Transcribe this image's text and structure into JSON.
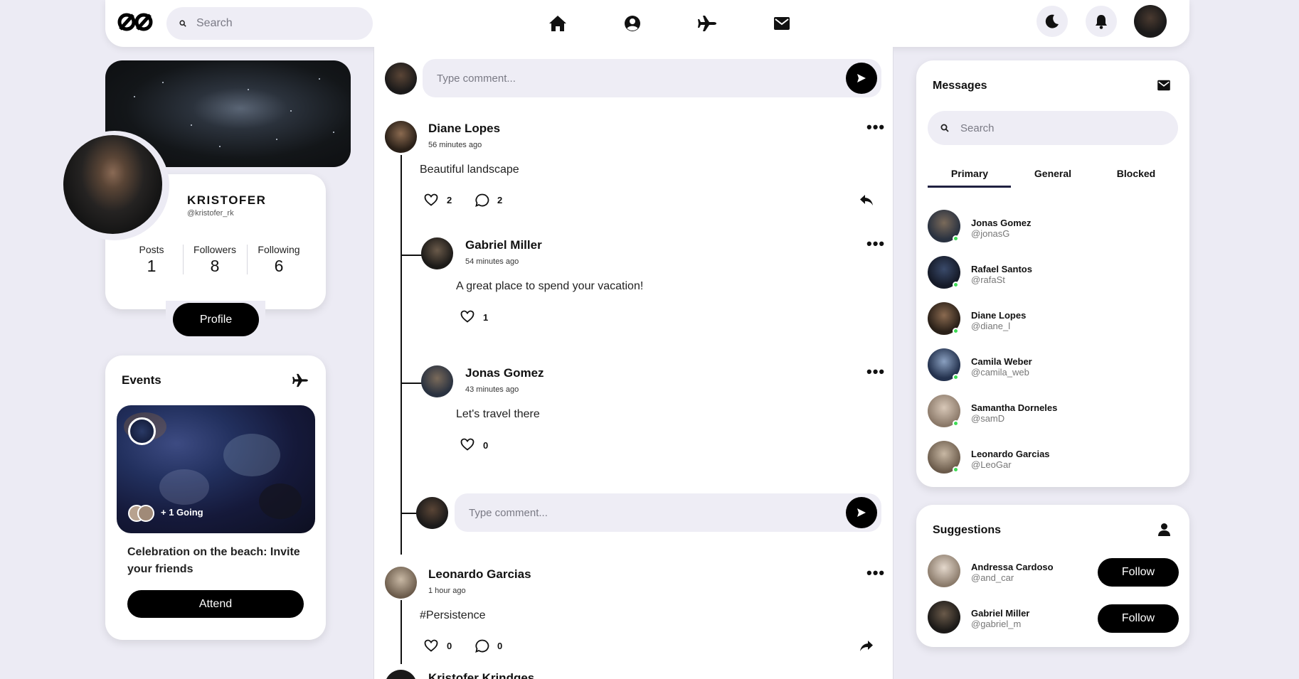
{
  "search": {
    "placeholder": "Search"
  },
  "profile": {
    "name": "KRISTOFER",
    "handle": "@kristofer_rk",
    "stats": [
      {
        "label": "Posts",
        "value": "1"
      },
      {
        "label": "Followers",
        "value": "8"
      },
      {
        "label": "Following",
        "value": "6"
      }
    ],
    "button": "Profile"
  },
  "events": {
    "title": "Events",
    "going": "+ 1 Going",
    "description": "Celebration on the beach: Invite your friends",
    "attend": "Attend"
  },
  "feed": {
    "comment_placeholder": "Type comment...",
    "posts": [
      {
        "author": "Diane Lopes",
        "time": "56 minutes ago",
        "text": "Beautiful landscape",
        "likes": "2",
        "comments": "2",
        "replies": [
          {
            "author": "Gabriel Miller",
            "time": "54 minutes ago",
            "text": "A great place to spend your vacation!",
            "likes": "1"
          },
          {
            "author": "Jonas Gomez",
            "time": "43 minutes ago",
            "text": "Let's travel there",
            "likes": "0"
          }
        ]
      },
      {
        "author": "Leonardo Garcias",
        "time": "1 hour ago",
        "text": "#Persistence",
        "likes": "0",
        "comments": "0"
      },
      {
        "author": "Kristofer Krindges"
      }
    ]
  },
  "messages": {
    "title": "Messages",
    "search_placeholder": "Search",
    "tabs": [
      "Primary",
      "General",
      "Blocked"
    ],
    "active_tab": "Primary",
    "contacts": [
      {
        "name": "Jonas Gomez",
        "handle": "@jonasG"
      },
      {
        "name": "Rafael Santos",
        "handle": "@rafaSt"
      },
      {
        "name": "Diane Lopes",
        "handle": "@diane_l"
      },
      {
        "name": "Camila Weber",
        "handle": "@camila_web"
      },
      {
        "name": "Samantha Dorneles",
        "handle": "@samD"
      },
      {
        "name": "Leonardo Garcias",
        "handle": "@LeoGar"
      }
    ]
  },
  "suggestions": {
    "title": "Suggestions",
    "people": [
      {
        "name": "Andressa Cardoso",
        "handle": "@and_car",
        "button": "Follow"
      },
      {
        "name": "Gabriel Miller",
        "handle": "@gabriel_m",
        "button": "Follow"
      }
    ]
  },
  "colors": {
    "accent": "#000000",
    "background": "#ecebf4",
    "online": "#3ddc55",
    "tab_underline": "#1f2040"
  }
}
